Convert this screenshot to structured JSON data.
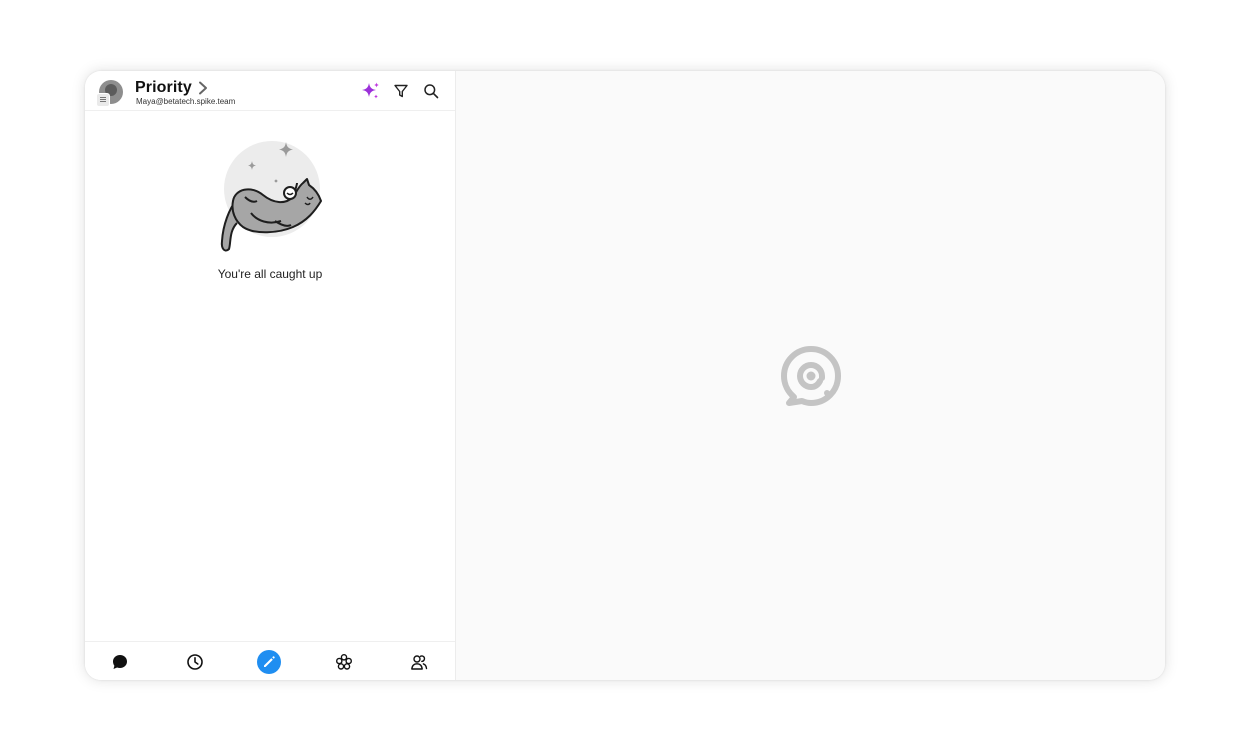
{
  "header": {
    "title": "Priority",
    "account_email": "Maya@betatech.spike.team",
    "icons": [
      "ai-sparkle-icon",
      "filter-icon",
      "search-icon"
    ]
  },
  "empty_state": {
    "message": "You're all caught up",
    "illustration": "sleeping-cat"
  },
  "bottom_nav": {
    "items": [
      "chat-icon",
      "clock-icon",
      "compose-pencil-icon",
      "groups-icon",
      "contacts-icon"
    ]
  },
  "colors": {
    "accent_blue": "#1f8ef1",
    "sparkle_purple": "#9b30d9",
    "logo_gray": "#c4c4c4",
    "panel_background": "#fafafa"
  }
}
